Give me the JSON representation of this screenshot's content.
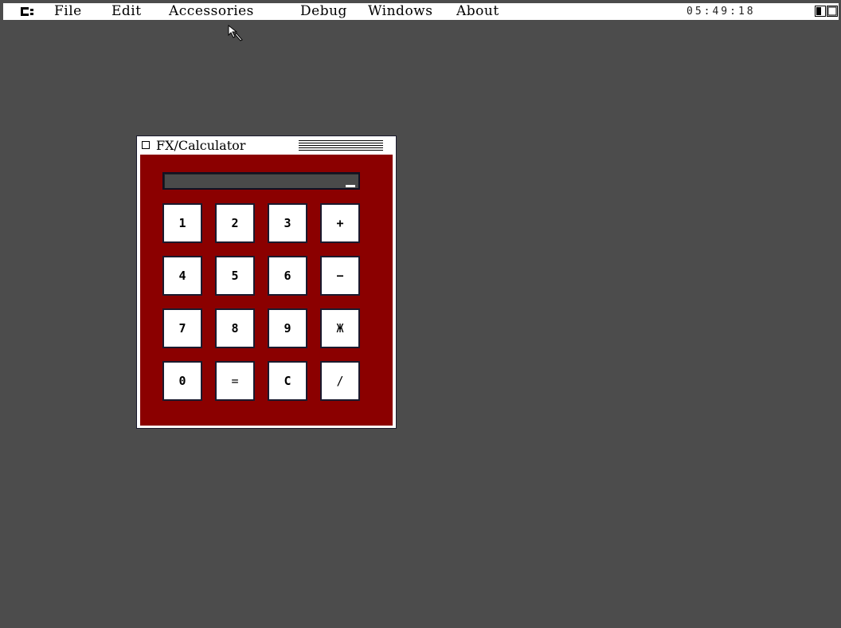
{
  "menubar": {
    "logo_icon": "atari-logo-icon",
    "items": [
      "File",
      "Edit",
      "Accessories",
      "Debug",
      "Windows",
      "About"
    ],
    "clock": "05:49:18",
    "tray_icon": "window-toggle-icon"
  },
  "cursor": {
    "icon": "arrow-pointer-icon"
  },
  "window": {
    "title": "FX/Calculator",
    "close_icon": "close-box-icon"
  },
  "calculator": {
    "display": "",
    "keys": [
      [
        "1",
        "2",
        "3",
        "+"
      ],
      [
        "4",
        "5",
        "6",
        "−"
      ],
      [
        "7",
        "8",
        "9",
        "Ж"
      ],
      [
        "0",
        "=",
        "C",
        "/"
      ]
    ]
  },
  "colors": {
    "desktop": "#4c4c4c",
    "menubar": "#ffffff",
    "calc_body": "#8b0000",
    "display_bg": "#4a4a4a",
    "key_bg": "#ffffff",
    "border": "#1a1a2e"
  }
}
